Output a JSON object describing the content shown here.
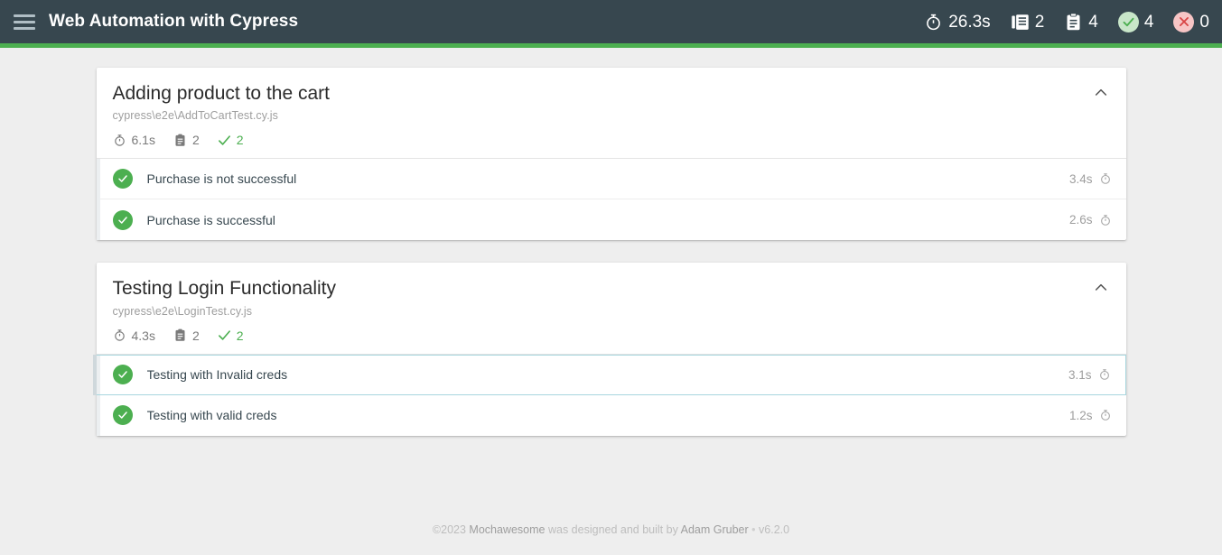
{
  "header": {
    "menu_icon": "hamburger-icon",
    "title": "Web Automation with Cypress",
    "stats": [
      {
        "icon": "stopwatch-icon",
        "value": "26.3s",
        "name": "duration"
      },
      {
        "icon": "suites-icon",
        "value": "2",
        "name": "suites"
      },
      {
        "icon": "tests-icon",
        "value": "4",
        "name": "tests"
      },
      {
        "icon": "check-circle-icon",
        "value": "4",
        "name": "passes"
      },
      {
        "icon": "times-circle-icon",
        "value": "0",
        "name": "failures"
      }
    ]
  },
  "colors": {
    "navbar": "#37474f",
    "progress": "#4caf50",
    "pass_green": "#4caf50",
    "fail_red": "#d84343",
    "page_bg": "#eeeeee",
    "badge_pass_bg": "#c8e6c9",
    "badge_fail_bg": "#f7c5c5",
    "selected_border": "#a7d6de"
  },
  "suites": [
    {
      "title": "Adding product to the cart",
      "path": "cypress\\e2e\\AddToCartTest.cy.js",
      "duration": "6.1s",
      "tests_count": "2",
      "passes_count": "2",
      "collapse_icon": "chevron-up-icon",
      "tests": [
        {
          "state": "passed",
          "title": "Purchase is not successful",
          "duration": "3.4s",
          "selected": false
        },
        {
          "state": "passed",
          "title": "Purchase is successful",
          "duration": "2.6s",
          "selected": false
        }
      ]
    },
    {
      "title": "Testing Login Functionality",
      "path": "cypress\\e2e\\LoginTest.cy.js",
      "duration": "4.3s",
      "tests_count": "2",
      "passes_count": "2",
      "collapse_icon": "chevron-up-icon",
      "tests": [
        {
          "state": "passed",
          "title": "Testing with Invalid creds",
          "duration": "3.1s",
          "selected": true
        },
        {
          "state": "passed",
          "title": "Testing with valid creds",
          "duration": "1.2s",
          "selected": false
        }
      ]
    }
  ],
  "footer": {
    "copyright": "©2023",
    "product": "Mochawesome",
    "middle": "was designed and built by",
    "author": "Adam Gruber",
    "separator": "•",
    "version": "v6.2.0"
  }
}
